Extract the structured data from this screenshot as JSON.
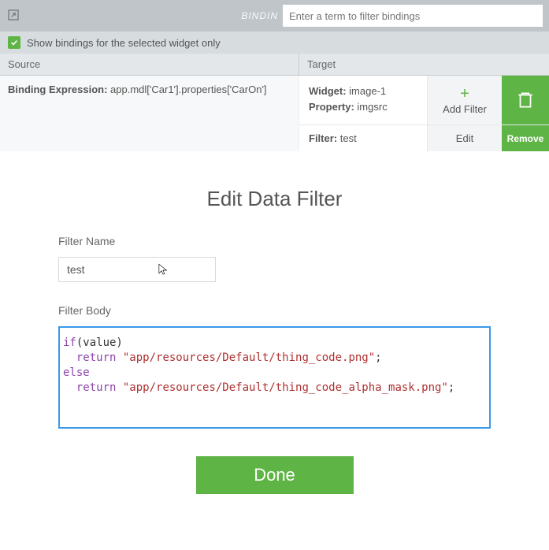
{
  "topbar": {
    "label": "BINDIN",
    "placeholder": "Enter a term to filter bindings"
  },
  "checkbox": {
    "label": "Show bindings for the selected widget only",
    "checked": true
  },
  "headers": {
    "source": "Source",
    "target": "Target"
  },
  "source": {
    "key": "Binding Expression:",
    "value": "app.mdl['Car1'].properties['CarOn']"
  },
  "target": {
    "widget_key": "Widget:",
    "widget_val": "image-1",
    "property_key": "Property:",
    "property_val": "imgsrc",
    "add_filter": "Add Filter",
    "filter_key": "Filter:",
    "filter_val": "test",
    "edit": "Edit",
    "remove": "Remove"
  },
  "modal": {
    "title": "Edit Data Filter",
    "name_label": "Filter Name",
    "name_value": "test",
    "body_label": "Filter Body",
    "code": {
      "l1_kw": "if",
      "l1_rest": "(value)",
      "l2_kw": "return",
      "l2_str": "\"app/resources/Default/thing_code.png\"",
      "l3_kw": "else",
      "l4_kw": "return",
      "l4_str": "\"app/resources/Default/thing_code_alpha_mask.png\""
    },
    "done": "Done"
  }
}
